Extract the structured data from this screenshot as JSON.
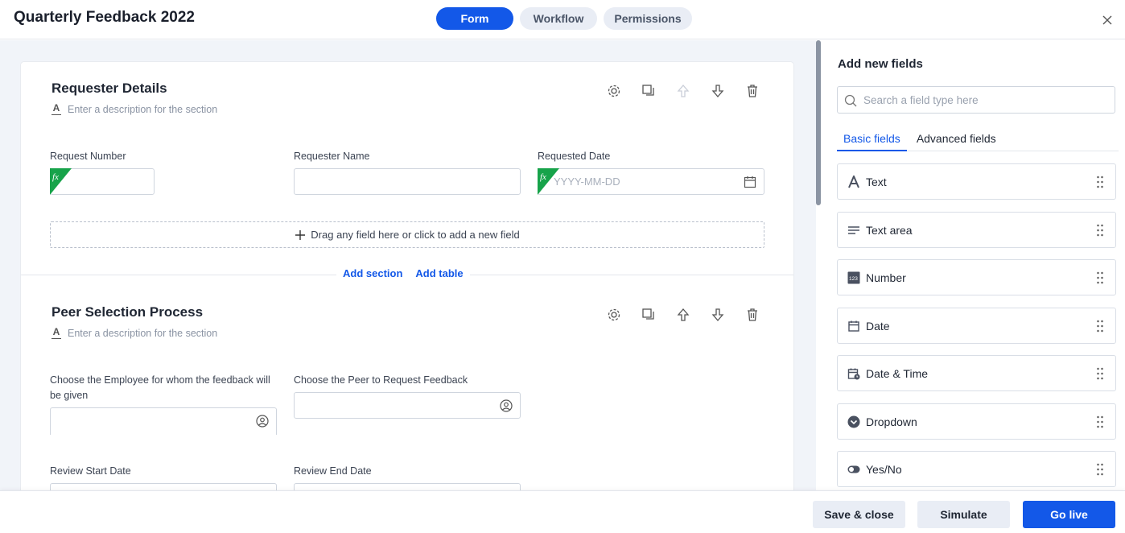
{
  "header": {
    "title": "Quarterly Feedback 2022",
    "tabs": [
      {
        "label": "Form",
        "active": true
      },
      {
        "label": "Workflow",
        "active": false
      },
      {
        "label": "Permissions",
        "active": false
      }
    ],
    "close_icon": "close-icon"
  },
  "sections": [
    {
      "title": "Requester Details",
      "description_placeholder": "Enter a description for the section",
      "fields": [
        {
          "label": "Request Number",
          "type": "formula",
          "value": ""
        },
        {
          "label": "Requester Name",
          "type": "text",
          "value": ""
        },
        {
          "label": "Requested Date",
          "type": "date-formula",
          "placeholder": "YYYY-MM-DD"
        }
      ],
      "drop_zone": "Drag any field here or click to add a new field"
    },
    {
      "title": "Peer Selection Process",
      "description_placeholder": "Enter a description for the section",
      "fields": [
        {
          "label": "Choose the Employee for whom the feedback will be given",
          "type": "user"
        },
        {
          "label": "Choose the Peer to Request Feedback",
          "type": "user"
        },
        {
          "label": "Review Start Date",
          "type": "date"
        },
        {
          "label": "Review End Date",
          "type": "date"
        }
      ]
    }
  ],
  "add_links": {
    "add_section": "Add section",
    "add_table": "Add table"
  },
  "sidebar": {
    "title": "Add new fields",
    "search_placeholder": "Search a field type here",
    "tabs": [
      {
        "label": "Basic fields",
        "active": true
      },
      {
        "label": "Advanced fields",
        "active": false
      }
    ],
    "fields": [
      {
        "label": "Text",
        "icon": "text-icon"
      },
      {
        "label": "Text area",
        "icon": "text-area-icon"
      },
      {
        "label": "Number",
        "icon": "number-icon"
      },
      {
        "label": "Date",
        "icon": "date-icon"
      },
      {
        "label": "Date & Time",
        "icon": "date-time-icon"
      },
      {
        "label": "Dropdown",
        "icon": "dropdown-icon"
      },
      {
        "label": "Yes/No",
        "icon": "toggle-icon"
      }
    ]
  },
  "footer": {
    "save_close": "Save & close",
    "simulate": "Simulate",
    "go_live": "Go live"
  },
  "colors": {
    "accent": "#1358e8",
    "formula": "#17a34a",
    "canvas_bg": "#f1f4f9"
  }
}
